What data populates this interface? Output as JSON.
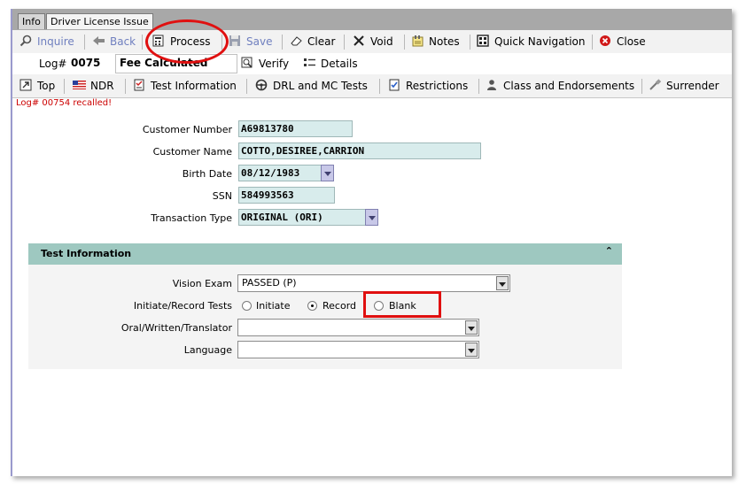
{
  "tabs": [
    {
      "label": "Info",
      "active": false
    },
    {
      "label": "Driver License Issue",
      "active": true
    }
  ],
  "toolbar": {
    "inquire": "Inquire",
    "back": "Back",
    "process": "Process",
    "save": "Save",
    "clear": "Clear",
    "void": "Void",
    "notes": "Notes",
    "quick_navigation": "Quick Navigation",
    "close": "Close"
  },
  "logbar": {
    "log_label": "Log#",
    "log_value": "0075",
    "status": "Fee Calculated",
    "verify": "Verify",
    "details": "Details"
  },
  "nav": {
    "top": "Top",
    "ndr": "NDR",
    "test_information": "Test Information",
    "drl_mc_tests": "DRL and MC Tests",
    "restrictions": "Restrictions",
    "class_endorsements": "Class and Endorsements",
    "surrender": "Surrender"
  },
  "message": "Log# 00754 recalled!",
  "customer": {
    "number_label": "Customer Number",
    "number": "A69813780",
    "name_label": "Customer Name",
    "name": "COTTO,DESIREE,CARRION",
    "birth_label": "Birth Date",
    "birth": "08/12/1983",
    "ssn_label": "SSN",
    "ssn": "584993563",
    "transaction_label": "Transaction Type",
    "transaction": "ORIGINAL (ORI)"
  },
  "test_info": {
    "heading": "Test Information",
    "vision_label": "Vision Exam",
    "vision_value": "PASSED (P)",
    "initiate_label": "Initiate/Record Tests",
    "options": [
      "Initiate",
      "Record",
      "Blank"
    ],
    "selected": "Record",
    "oral_label": "Oral/Written/Translator",
    "oral_value": "",
    "language_label": "Language",
    "language_value": ""
  },
  "colors": {
    "field_bg": "#d8ecec",
    "section_header": "#9ec8c0",
    "message_red": "#cc0000",
    "callout_red": "#e01010",
    "disabled_link": "#6f7fbf"
  }
}
